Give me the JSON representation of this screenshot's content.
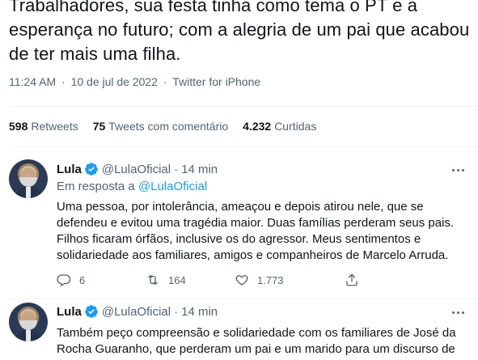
{
  "main_tweet": {
    "text": "Trabalhadores, sua festa tinha como tema o PT e a esperança no futuro; com a alegria de um pai que acabou de ter mais uma filha.",
    "time": "11:24 AM",
    "date": "10 de jul de 2022",
    "source": "Twitter for iPhone",
    "separator": "·"
  },
  "stats": {
    "retweets_count": "598",
    "retweets_label": "Retweets",
    "quotes_count": "75",
    "quotes_label": "Tweets com comentário",
    "likes_count": "4.232",
    "likes_label": "Curtidas"
  },
  "replies": [
    {
      "name": "Lula",
      "handle": "@LulaOficial",
      "separator": "·",
      "time": "14 min",
      "in_reply_prefix": "Em resposta a",
      "in_reply_handle": "@LulaOficial",
      "text": "Uma pessoa, por intolerância, ameaçou e depois atirou nele, que se defendeu e evitou uma tragédia maior. Duas famílias perderam seus pais. Filhos ficaram órfãos, inclusive os do agressor. Meus sentimentos e solidariedade aos familiares, amigos e companheiros de Marcelo Arruda.",
      "reply_count": "6",
      "retweet_count": "164",
      "like_count": "1.773"
    },
    {
      "name": "Lula",
      "handle": "@LulaOficial",
      "separator": "·",
      "time": "14 min",
      "text": "Também peço compreensão e solidariedade com os familiares de José da Rocha Guaranho, que perderam um pai e um marido para um discurso de ódio..."
    }
  ],
  "colors": {
    "accent": "#1d9bf0",
    "secondary_text": "#536471",
    "primary_text": "#0f1419",
    "divider": "#eff3f4"
  },
  "icons": [
    "verified-badge-icon",
    "more-icon",
    "reply-icon",
    "retweet-icon",
    "like-icon",
    "share-icon"
  ]
}
